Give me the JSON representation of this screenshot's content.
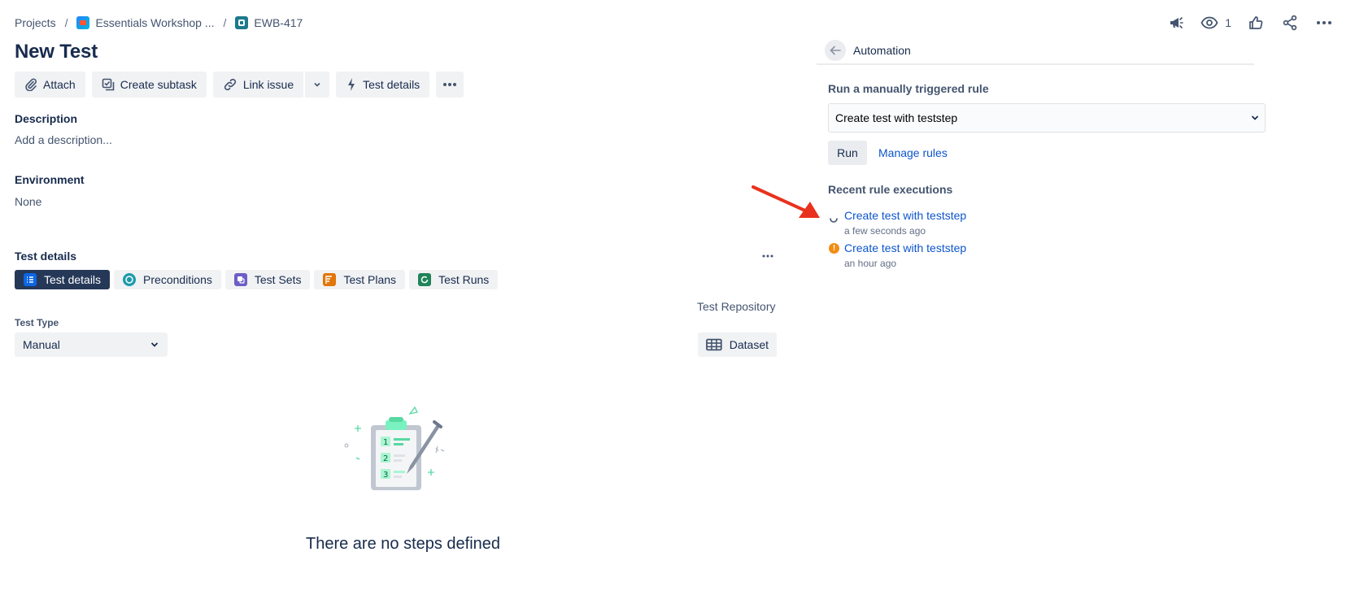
{
  "breadcrumb": {
    "projects": "Projects",
    "separator": "/",
    "project": "Essentials Workshop ...",
    "issue_key": "EWB-417"
  },
  "header": {
    "watch_count": "1"
  },
  "issue": {
    "title": "New Test"
  },
  "toolbar": {
    "attach": "Attach",
    "create_subtask": "Create subtask",
    "link_issue": "Link issue",
    "test_details": "Test details"
  },
  "description": {
    "label": "Description",
    "placeholder": "Add a description..."
  },
  "environment": {
    "label": "Environment",
    "value": "None"
  },
  "test_details_section": {
    "label": "Test details",
    "tabs": [
      {
        "label": "Test details",
        "color": "#0c66e4"
      },
      {
        "label": "Preconditions",
        "color": "#1d9aaa"
      },
      {
        "label": "Test Sets",
        "color": "#6e5dc6"
      },
      {
        "label": "Test Plans",
        "color": "#e2760b"
      },
      {
        "label": "Test Runs",
        "color": "#1f845a"
      }
    ],
    "test_repository": "Test Repository",
    "test_type_label": "Test Type",
    "test_type_value": "Manual",
    "dataset": "Dataset",
    "empty_message": "There are no steps defined"
  },
  "automation": {
    "title": "Automation",
    "run_label": "Run a manually triggered rule",
    "selected_rule": "Create test with teststep",
    "run_button": "Run",
    "manage_rules": "Manage rules",
    "recent_label": "Recent rule executions",
    "executions": [
      {
        "name": "Create test with teststep",
        "time": "a few seconds ago",
        "status": "in-progress"
      },
      {
        "name": "Create test with teststep",
        "time": "an hour ago",
        "status": "warning"
      }
    ]
  },
  "colors": {
    "link": "#0c55cc",
    "annotation_arrow": "#e8321e",
    "active_tab": "#253858",
    "warning": "#f18d13"
  }
}
